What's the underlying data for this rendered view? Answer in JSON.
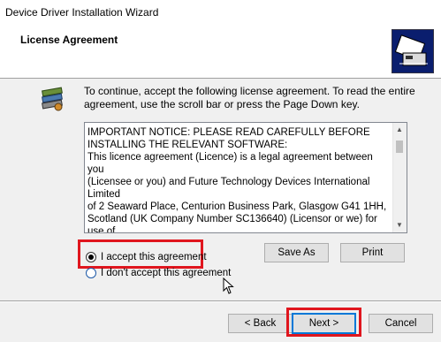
{
  "window": {
    "title": "Device Driver Installation Wizard"
  },
  "header": {
    "title": "License Agreement",
    "icon": "driver-install-icon"
  },
  "intro": "To continue, accept the following license agreement. To read the entire agreement, use the scroll bar or press the Page Down key.",
  "license": {
    "text": "IMPORTANT NOTICE: PLEASE READ CAREFULLY BEFORE\nINSTALLING THE RELEVANT SOFTWARE:\nThis licence agreement (Licence) is a legal agreement between you\n(Licensee or you) and Future Technology Devices International Limited\nof 2 Seaward Place, Centurion Business Park, Glasgow G41 1HH,\nScotland (UK Company Number SC136640) (Licensor or we) for use of\ndriver software provided by the Licensor(Software).\n\nBY INSTALLING OR USING THIS SOFTWARE YOU AGREE TO THE"
  },
  "options": {
    "accept_label": "I accept this agreement",
    "decline_label": "I don't accept this agreement",
    "selected": "accept"
  },
  "buttons": {
    "save_as": "Save As",
    "print": "Print",
    "back": "< Back",
    "next": "Next >",
    "cancel": "Cancel"
  },
  "colors": {
    "highlight": "#e0161e",
    "header_icon_bg": "#0a1e6e",
    "focus": "#0078d7"
  }
}
